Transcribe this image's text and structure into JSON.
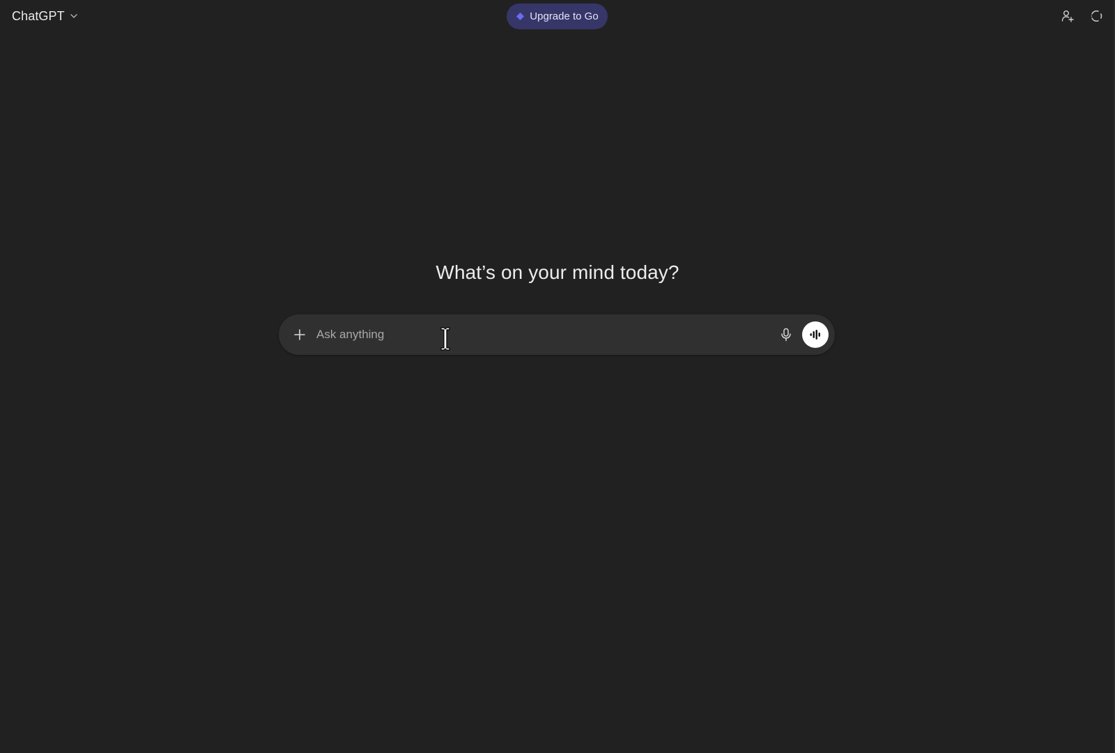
{
  "header": {
    "model_name": "ChatGPT",
    "upgrade_label": "Upgrade to Go",
    "upgrade_color": "#373669",
    "upgrade_icon": "diamond-icon",
    "share_icon": "add-person-icon",
    "temporary_chat_icon": "temporary-chat-icon"
  },
  "main": {
    "headline": "What’s on your mind today?"
  },
  "composer": {
    "placeholder": "Ask anything",
    "value": "",
    "attach_icon": "plus-icon",
    "dictate_icon": "microphone-icon",
    "voice_icon": "voice-mode-icon"
  },
  "theme": {
    "background": "#212121",
    "composer_background": "#303030",
    "accent": "#6c6cf0"
  }
}
